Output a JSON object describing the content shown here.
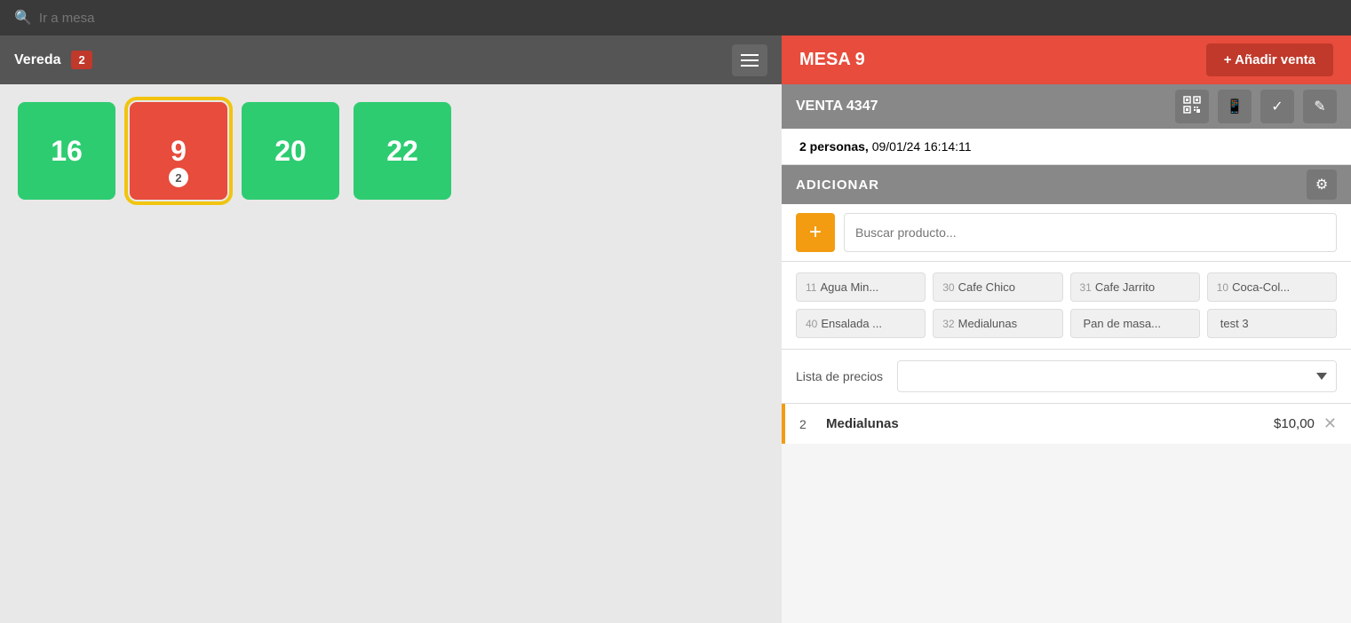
{
  "topbar": {
    "search_placeholder": "Ir a mesa"
  },
  "left": {
    "area_label": "Vereda",
    "badge": "2",
    "tables": [
      {
        "id": "t16",
        "number": "16",
        "color": "green",
        "selected": false,
        "badge": null
      },
      {
        "id": "t9",
        "number": "9",
        "color": "red",
        "selected": true,
        "badge": "2"
      },
      {
        "id": "t20",
        "number": "20",
        "color": "green",
        "selected": false,
        "badge": null
      },
      {
        "id": "t22",
        "number": "22",
        "color": "green",
        "selected": false,
        "badge": null
      }
    ]
  },
  "right": {
    "header": {
      "mesa_title": "MESA 9",
      "add_sale_label": "+ Añadir venta"
    },
    "venta": {
      "title": "VENTA 4347"
    },
    "info": {
      "personas": "2 personas,",
      "datetime": "09/01/24 16:14:11"
    },
    "adicionar": {
      "title": "ADICIONAR"
    },
    "search": {
      "placeholder": "Buscar producto...",
      "add_btn": "+"
    },
    "products": [
      {
        "id": "p11",
        "num": "11",
        "name": "Agua Min..."
      },
      {
        "id": "p30",
        "num": "30",
        "name": "Cafe Chico"
      },
      {
        "id": "p31",
        "num": "31",
        "name": "Cafe Jarrito"
      },
      {
        "id": "p10",
        "num": "10",
        "name": "Coca-Col..."
      },
      {
        "id": "p40",
        "num": "40",
        "name": "Ensalada ..."
      },
      {
        "id": "p32",
        "num": "32",
        "name": "Medialunas"
      },
      {
        "id": "ppm",
        "num": "",
        "name": "Pan de masa..."
      },
      {
        "id": "pt3",
        "num": "",
        "name": "test 3"
      }
    ],
    "price_list": {
      "label": "Lista de precios",
      "options": [
        ""
      ]
    },
    "order_items": [
      {
        "qty": "2",
        "name": "Medialunas",
        "price": "$10,00"
      }
    ]
  }
}
